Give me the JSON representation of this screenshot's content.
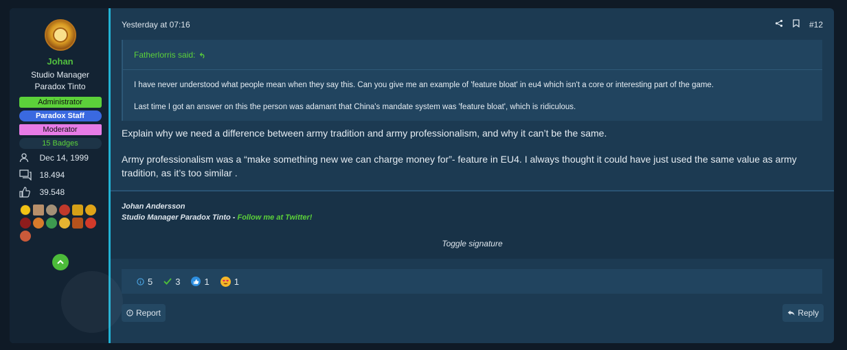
{
  "user": {
    "name": "Johan",
    "title": "Studio Manager",
    "studio": "Paradox Tinto",
    "banners": [
      "Administrator",
      "Paradox Staff",
      "Moderator"
    ],
    "badges": "15 Badges",
    "joined": "Dec 14, 1999",
    "messages": "18.494",
    "reactions": "39.548"
  },
  "post": {
    "timestamp": "Yesterday at 07:16",
    "number": "#12",
    "quote_author": "Fatherlorris said:",
    "quote_lines": [
      "I have never understood what people mean when they say this. Can you give me an example of 'feature bloat' in eu4 which isn't a core or interesting part of the game.",
      "Last time I got an answer on this the person was adamant that China's mandate system was 'feature bloat', which is ridiculous."
    ],
    "body": [
      "Explain why we need a difference between army tradition and army professionalism, and why it can’t be the same.",
      "Army professionalism was a “make something new we can charge money for”- feature in EU4. I always thought it could have just used the same value as army tradition, as it’s too similar ."
    ],
    "signature_name": "Johan Andersson",
    "signature_role": "Studio Manager Paradox Tinto - ",
    "signature_link": "Follow me at Twitter!",
    "toggle_signature": "Toggle signature",
    "reactions": {
      "info": "5",
      "agree": "3",
      "like": "1",
      "love": "1"
    },
    "report_label": "Report",
    "reply_label": "Reply"
  },
  "colors": {
    "accent": "#22b3d6",
    "username": "#52c03f",
    "admin": "#5cd13a",
    "staff": "#3a69e0",
    "moderator": "#e77be6"
  }
}
